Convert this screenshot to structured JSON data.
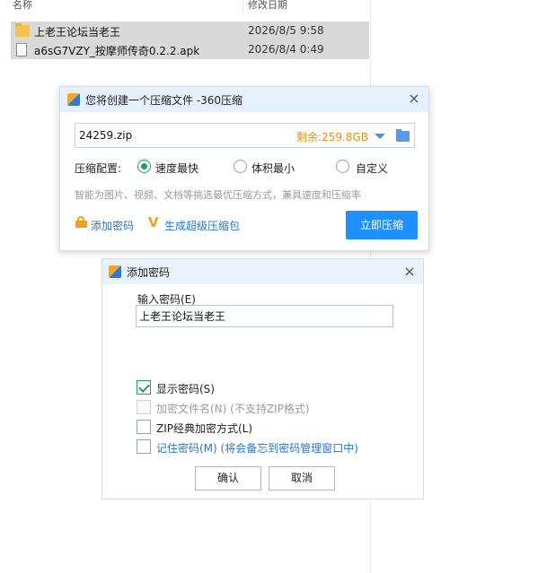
{
  "explorer": {
    "columns": {
      "name": "名称",
      "date": "修改日期"
    },
    "files": [
      {
        "name": "上老王论坛当老王",
        "date": "2026/8/5 9:58",
        "icon": "folder-icon"
      },
      {
        "name": "a6sG7VZY_按摩师传奇0.2.2.apk",
        "date": "2026/8/4 0:49",
        "icon": "file-icon"
      }
    ]
  },
  "compress_dialog": {
    "title": "您将创建一个压缩文件 -360压缩",
    "close": "×",
    "filename": "24259.zip",
    "free_space": "剩余:259.8GB",
    "config_label": "压缩配置:",
    "options": [
      {
        "label": "速度最快",
        "checked": true
      },
      {
        "label": "体积最小",
        "checked": false
      },
      {
        "label": "自定义",
        "checked": false
      }
    ],
    "hint": "智能为图片、视频、文档等挑选最优压缩方式，兼具速度和压缩率",
    "add_password_link": "添加密码",
    "super_compress_link": "生成超级压缩包",
    "v_glyph": "V",
    "compress_button": "立即压缩",
    "colors": {
      "accent": "#1e90ff",
      "space": "#f08c00",
      "link": "#2a75c9"
    }
  },
  "password_dialog": {
    "title": "添加密码",
    "close": "×",
    "input_label": "输入密码(E)",
    "password_value": "上老王论坛当老王",
    "checkboxes": [
      {
        "label": "显示密码(S)",
        "checked": true,
        "disabled": false
      },
      {
        "label": "加密文件名(N) (不支持ZIP格式)",
        "checked": false,
        "disabled": true
      },
      {
        "label": "ZIP经典加密方式(L)",
        "checked": false,
        "disabled": false
      },
      {
        "label": "记住密码(M) (将会备忘到密码管理窗口中)",
        "checked": false,
        "disabled": false
      }
    ],
    "ok_button": "确认",
    "cancel_button": "取消"
  }
}
